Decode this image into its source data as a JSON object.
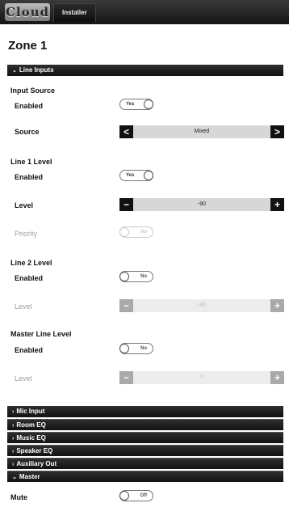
{
  "header": {
    "logo": "Cloud",
    "tab": "Installer"
  },
  "page_title": "Zone 1",
  "sections": {
    "line_inputs": "Line Inputs",
    "mic_input": "Mic Input",
    "room_eq": "Room EQ",
    "music_eq": "Music EQ",
    "speaker_eq": "Speaker EQ",
    "auxiliary_out": "Auxiliary Out",
    "master": "Master"
  },
  "icons": {
    "expanded": "chevron-down-icon",
    "collapsed": "chevron-right-icon"
  },
  "input_source": {
    "title": "Input Source",
    "enabled_label": "Enabled",
    "enabled_value": "Yes",
    "source_label": "Source",
    "source_value": "Mixed"
  },
  "line1": {
    "title": "Line 1 Level",
    "enabled_label": "Enabled",
    "enabled_value": "Yes",
    "level_label": "Level",
    "level_value": "-90",
    "priority_label": "Priority",
    "priority_value": "No"
  },
  "line2": {
    "title": "Line 2 Level",
    "enabled_label": "Enabled",
    "enabled_value": "No",
    "level_label": "Level",
    "level_value": "-90"
  },
  "master_line": {
    "title": "Master Line Level",
    "enabled_label": "Enabled",
    "enabled_value": "No",
    "level_label": "Level",
    "level_value": "0"
  },
  "master": {
    "mute_label": "Mute",
    "mute_value": "Off"
  },
  "glyphs": {
    "left": "<",
    "right": ">",
    "minus": "−",
    "plus": "+",
    "down": "⌄",
    "chev_right": "›"
  }
}
